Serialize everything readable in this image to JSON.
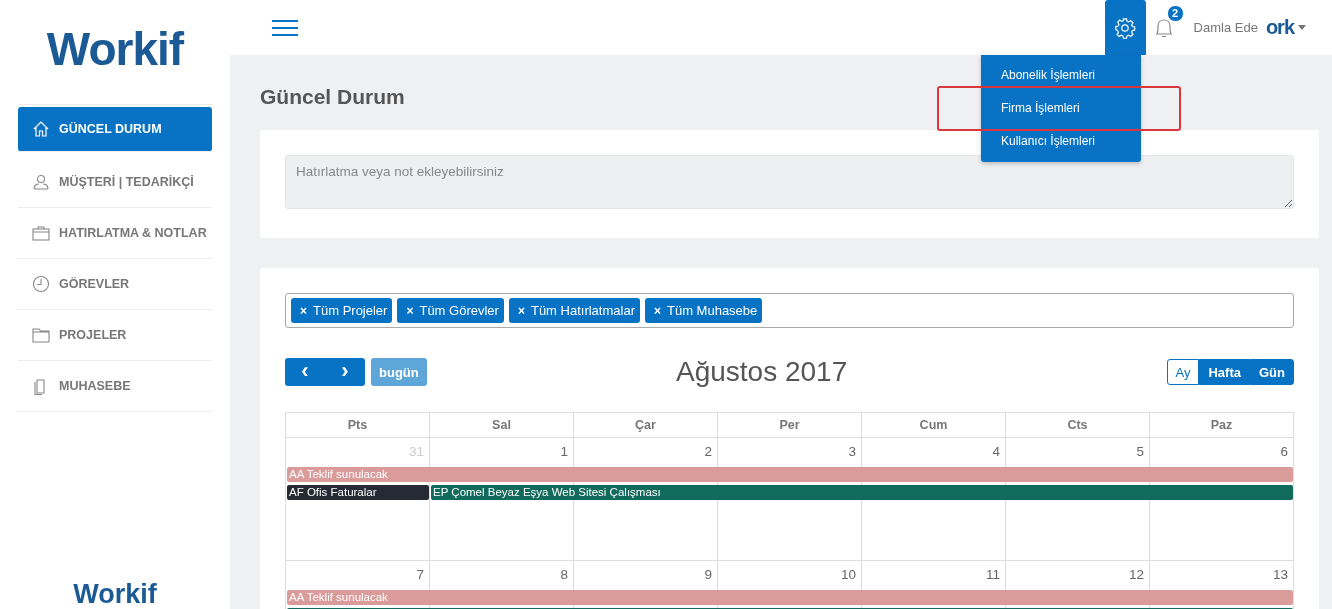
{
  "sidebar": {
    "logo": "Workif",
    "items": [
      {
        "label": "GÜNCEL DURUM",
        "selected": true
      },
      {
        "label": "MÜŞTERİ | TEDARİKÇİ",
        "selected": false
      },
      {
        "label": "HATIRLATMA & NOTLAR",
        "selected": false
      },
      {
        "label": "GÖREVLER",
        "selected": false
      },
      {
        "label": "PROJELER",
        "selected": false
      },
      {
        "label": "MUHASEBE",
        "selected": false
      }
    ],
    "footer_logo": "Workif"
  },
  "topbar": {
    "notification_count": "2",
    "user_name": "Damla Ede",
    "avatar_logo": "ork",
    "settings_menu": {
      "expanded": true,
      "items": [
        {
          "label": "Abonelik İşlemleri",
          "highlighted": false
        },
        {
          "label": "Firma İşlemleri",
          "highlighted": true
        },
        {
          "label": "Kullanıcı İşlemleri",
          "highlighted": false
        }
      ]
    }
  },
  "page_title": "Güncel Durum",
  "note": {
    "placeholder": "Hatırlatma veya not ekleyebilirsiniz"
  },
  "filters": [
    {
      "label": "Tüm Projeler",
      "remove": "×"
    },
    {
      "label": "Tüm Görevler",
      "remove": "×"
    },
    {
      "label": "Tüm Hatırlatmalar",
      "remove": "×"
    },
    {
      "label": "Tüm Muhasebe",
      "remove": "×"
    }
  ],
  "calendar": {
    "prev": "‹",
    "next": "›",
    "today": "bugün",
    "title": "Ağustos 2017",
    "views": [
      {
        "label": "Ay",
        "selected": true
      },
      {
        "label": "Hafta",
        "selected": false
      },
      {
        "label": "Gün",
        "selected": false
      }
    ],
    "weekdays": [
      "Pts",
      "Sal",
      "Çar",
      "Per",
      "Cum",
      "Cts",
      "Paz"
    ],
    "weeks": [
      {
        "days": [
          {
            "day": "31",
            "other_month": true
          },
          {
            "day": "1",
            "other_month": false
          },
          {
            "day": "2",
            "other_month": false
          },
          {
            "day": "3",
            "other_month": false
          },
          {
            "day": "4",
            "other_month": false
          },
          {
            "day": "5",
            "other_month": false
          },
          {
            "day": "6",
            "other_month": false
          }
        ],
        "events": [
          {
            "title": "AA Teklif sunulacak",
            "kind": "week",
            "color": "#d99c9b"
          },
          {
            "title": "AF Ofis Faturalar",
            "kind": "first-day",
            "color": "#262a35"
          },
          {
            "title": "EP Çomel Beyaz Eşya Web Sitesi Çalışması",
            "kind": "rest-of-week",
            "color": "#116b5c"
          }
        ]
      },
      {
        "days": [
          {
            "day": "7",
            "other_month": false
          },
          {
            "day": "8",
            "other_month": false
          },
          {
            "day": "9",
            "other_month": false
          },
          {
            "day": "10",
            "other_month": false
          },
          {
            "day": "11",
            "other_month": false
          },
          {
            "day": "12",
            "other_month": false
          },
          {
            "day": "13",
            "other_month": false
          }
        ],
        "events": [
          {
            "title": "AA Teklif sunulacak",
            "kind": "week",
            "color": "#d99c9b"
          },
          {
            "kind": "week-second-line",
            "color": "#116b5c"
          }
        ]
      }
    ]
  }
}
